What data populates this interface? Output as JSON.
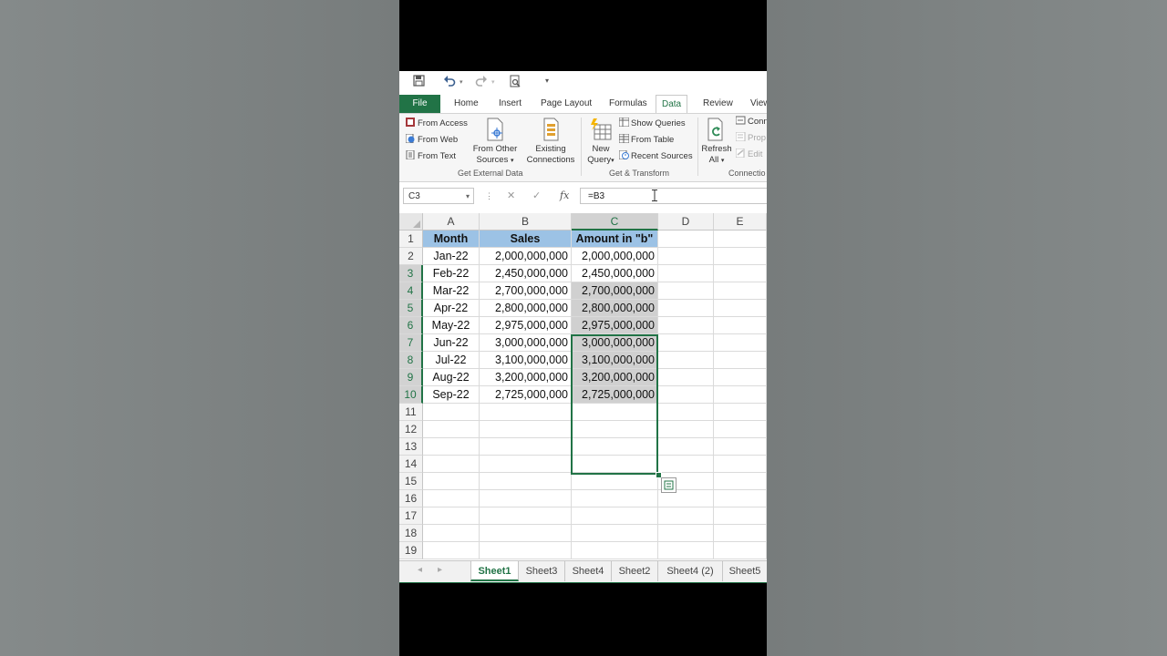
{
  "qat": {
    "icons": [
      "save-icon",
      "undo-icon",
      "redo-icon",
      "print-preview-icon",
      "customize-qat-icon"
    ]
  },
  "tabs": [
    "File",
    "Home",
    "Insert",
    "Page Layout",
    "Formulas",
    "Data",
    "Review",
    "View"
  ],
  "active_tab": "Data",
  "ribbon": {
    "get_external": {
      "from_access": "From Access",
      "from_web": "From Web",
      "from_text": "From Text",
      "from_other_1": "From Other",
      "from_other_2": "Sources",
      "existing_1": "Existing",
      "existing_2": "Connections",
      "label": "Get External Data"
    },
    "get_transform": {
      "new_query_1": "New",
      "new_query_2": "Query",
      "show_queries": "Show Queries",
      "from_table": "From Table",
      "recent_sources": "Recent Sources",
      "label": "Get & Transform"
    },
    "connections": {
      "refresh_1": "Refresh",
      "refresh_2": "All",
      "connections": "Conn",
      "properties": "Prop",
      "edit_links": "Edit",
      "label": "Connectio"
    }
  },
  "formula_bar": {
    "name_box": "C3",
    "fx": "fx",
    "formula": "=B3"
  },
  "columns": [
    "A",
    "B",
    "C",
    "D",
    "E"
  ],
  "selected_column": "C",
  "rows": [
    "1",
    "2",
    "3",
    "4",
    "5",
    "6",
    "7",
    "8",
    "9",
    "10",
    "11",
    "12",
    "13",
    "14",
    "15",
    "16",
    "17",
    "18",
    "19"
  ],
  "table": {
    "headers": [
      "Month",
      "Sales",
      "Amount in \"b\""
    ],
    "data": [
      [
        "Jan-22",
        "2,000,000,000",
        "2,000,000,000"
      ],
      [
        "Feb-22",
        "2,450,000,000",
        "2,450,000,000"
      ],
      [
        "Mar-22",
        "2,700,000,000",
        "2,700,000,000"
      ],
      [
        "Apr-22",
        "2,800,000,000",
        "2,800,000,000"
      ],
      [
        "May-22",
        "2,975,000,000",
        "2,975,000,000"
      ],
      [
        "Jun-22",
        "3,000,000,000",
        "3,000,000,000"
      ],
      [
        "Jul-22",
        "3,100,000,000",
        "3,100,000,000"
      ],
      [
        "Aug-22",
        "3,200,000,000",
        "3,200,000,000"
      ],
      [
        "Sep-22",
        "2,725,000,000",
        "2,725,000,000"
      ]
    ]
  },
  "sheets": [
    "Sheet1",
    "Sheet3",
    "Sheet4",
    "Sheet2",
    "Sheet4 (2)",
    "Sheet5"
  ],
  "active_sheet": "Sheet1",
  "colors": {
    "excel_green": "#217346",
    "header_fill": "#9cc2e5",
    "selection_fill": "#d0d0d0"
  }
}
